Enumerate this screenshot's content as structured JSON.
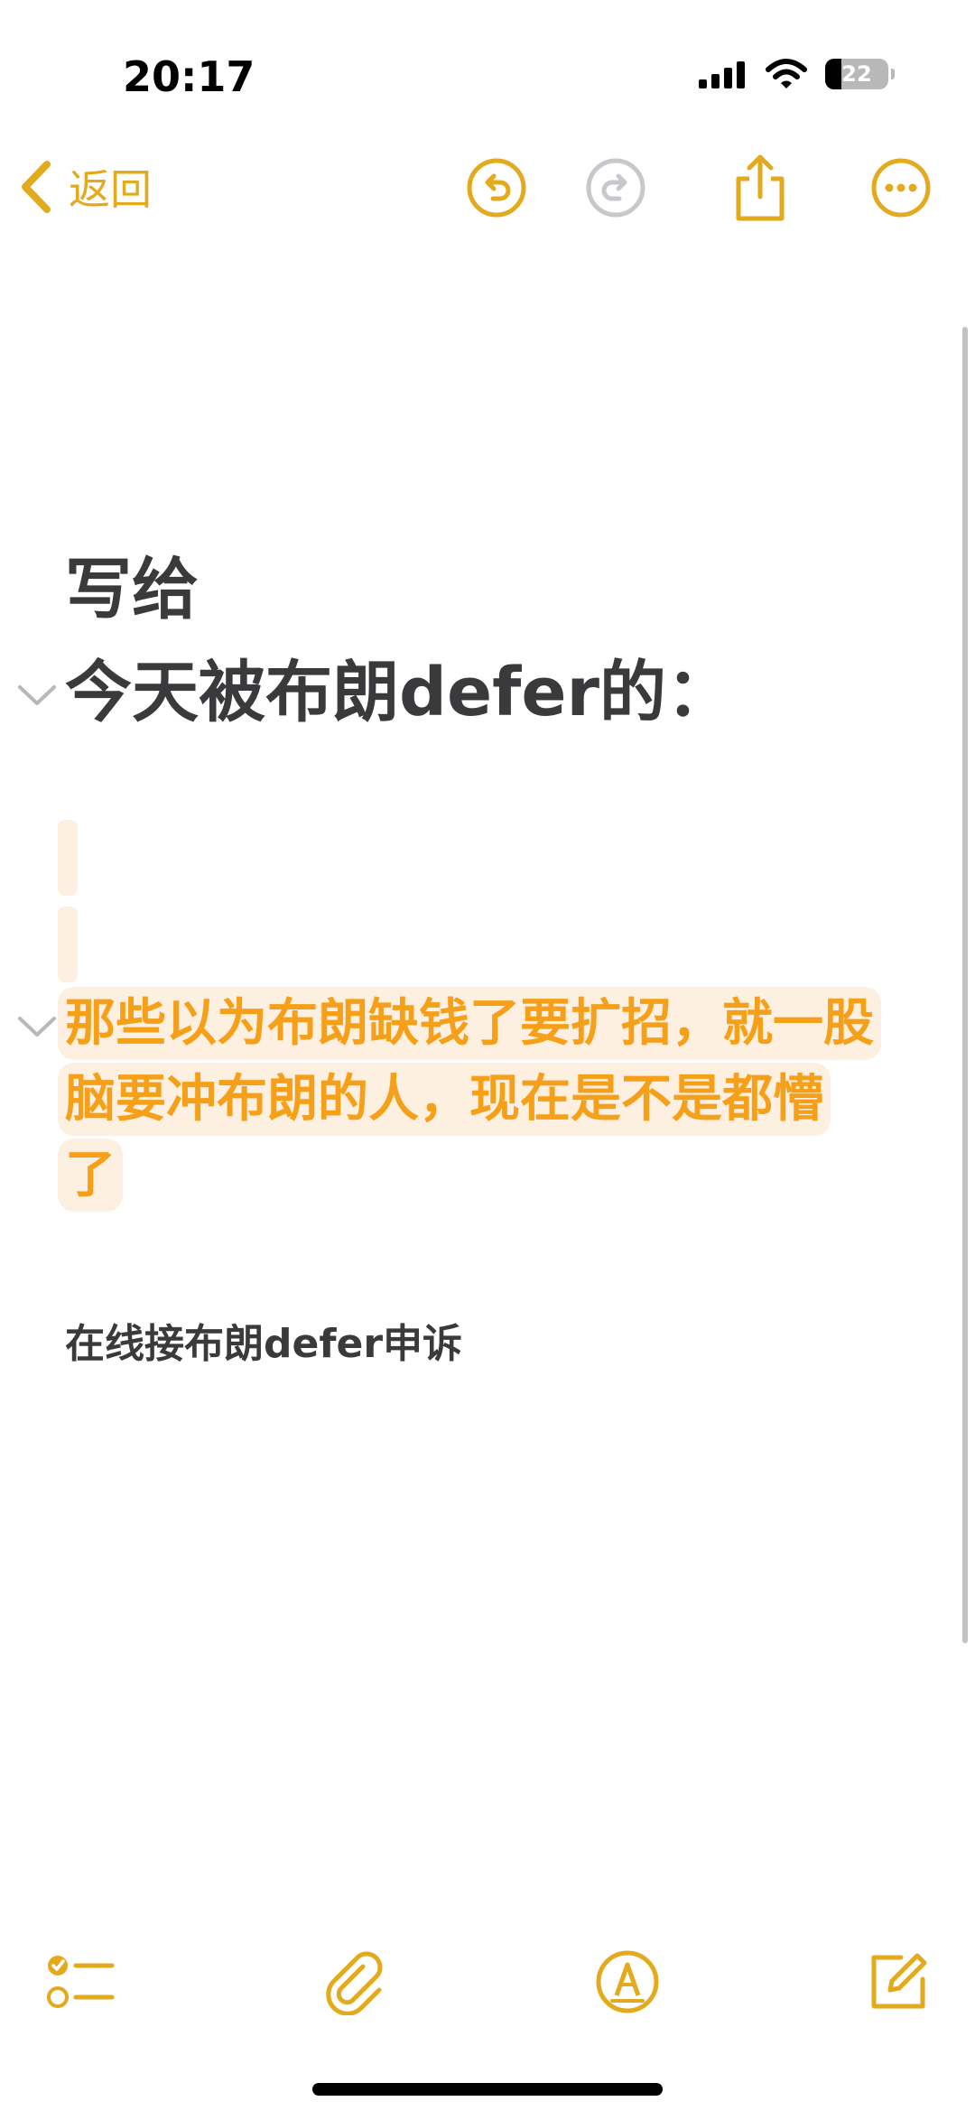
{
  "status_bar": {
    "time": "20:17",
    "battery_level": "22",
    "icons": [
      "signal-icon",
      "wifi-icon",
      "battery-icon"
    ]
  },
  "nav": {
    "back_label": "返回",
    "accent_color": "#e2aa1c",
    "disabled_color": "#c7c7cc",
    "icons": [
      "back-chevron-icon",
      "undo-icon",
      "redo-icon",
      "share-icon",
      "more-icon"
    ]
  },
  "note": {
    "heading_line_1": "写给",
    "heading_line_2": "今天被布朗defer的：",
    "highlight_paragraph": "那些以为布朗缺钱了要扩招，就一股脑要冲布朗的人，现在是不是都懵了",
    "body_text": "在线接布朗defer申诉",
    "highlight_text_color": "#f6a01a",
    "highlight_background": "#fdf0e0"
  },
  "toolbar": {
    "icons": [
      "checklist-icon",
      "attachment-icon",
      "markup-icon",
      "compose-icon"
    ]
  }
}
